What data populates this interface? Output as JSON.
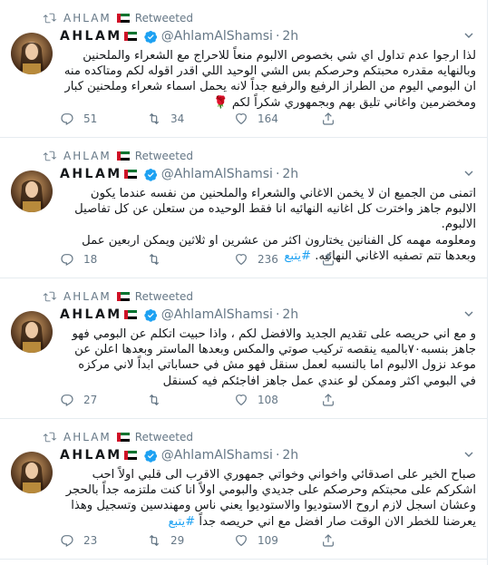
{
  "tweets": [
    {
      "retweeted_by": "AHLAM",
      "retweeted_label": "Retweeted",
      "author_name": "AHLAM",
      "handle": "@AhlamAlShamsi",
      "time": "2h",
      "text": "لذا ارجوا عدم تداول اي شي بخصوص الالبوم منعاً للاحراج مع الشعراء والملحنين وبالنهايه مقدره محبتكم وحرصكم بس الشي الوحيد اللي اقدر اقوله لكم ومتاكده منه ان البومي اليوم من الطراز الرفيع والرفيع جداً لانه يحمل اسماء شعراء وملحنين كبار ومخضرمين واغاني تليق بهم وبجمهوري شكراً لكم 🌹",
      "hashtag": "",
      "replies": "51",
      "retweets": "34",
      "likes": "164"
    },
    {
      "retweeted_by": "AHLAM",
      "retweeted_label": "Retweeted",
      "author_name": "AHLAM",
      "handle": "@AhlamAlShamsi",
      "time": "2h",
      "text": "اتمنى من الجميع ان لا يخمن الاغاني والشعراء والملحنين من نفسه عندما يكون الالبوم جاهز واخترت كل اغانيه النهائيه انا فقط الوحيده من ستعلن عن كل تفاصيل الالبوم.\nومعلومه مهمه كل الفنانين يختارون اكثر من عشرين او ثلاثين ويمكن اربعين عمل وبعدها تتم تصفيه الاغاني النهائيه.",
      "hashtag": "#يتبع",
      "replies": "18",
      "retweets": "",
      "likes": "236"
    },
    {
      "retweeted_by": "AHLAM",
      "retweeted_label": "Retweeted",
      "author_name": "AHLAM",
      "handle": "@AhlamAlShamsi",
      "time": "2h",
      "text": "و مع اني حريصه على تقديم الجديد والافضل لكم ، واذا حبيت اتكلم عن البومي فهو جاهز بنسبه٧٠بالميه ينقصه تركيب صوتي والمكس وبعدها الماستر وبعدها اعلن عن موعد نزول الالبوم اما بالنسبه لعمل سنقل فهو مش في حساباتي ابداً لاني مركزه في البومي اكثر وممكن لو عندي عمل جاهز افاجئكم فيه كسنقل",
      "hashtag": "",
      "replies": "27",
      "retweets": "",
      "likes": "108"
    },
    {
      "retweeted_by": "AHLAM",
      "retweeted_label": "Retweeted",
      "author_name": "AHLAM",
      "handle": "@AhlamAlShamsi",
      "time": "2h",
      "text": "صباح الخير على اصدقائي واخواني وخواتي جمهوري الاقرب الى قلبي اولاً احب اشكركم على محبتكم وحرصكم على جديدي والبومي اولاً انا كنت ملتزمه جداً بالحجر وعشان اسجل لازم اروح الاستوديوا والاستوديوا يعني ناس ومهندسين وتسجيل وهذا يعرضنا للخطر الان الوقت صار افضل مع اني حريصه جداً",
      "hashtag": "#يتبع",
      "replies": "23",
      "retweets": "29",
      "likes": "109"
    }
  ],
  "colors": {
    "muted": "#657786",
    "link": "#1da1f2",
    "verified": "#1da1f2",
    "divider": "#e6ecf0",
    "rose": "#c0392b"
  },
  "icons": [
    "retweet-icon",
    "uae-flag-icon",
    "verified-badge-icon",
    "chevron-down-icon",
    "reply-icon",
    "like-icon",
    "share-icon",
    "avatar"
  ]
}
